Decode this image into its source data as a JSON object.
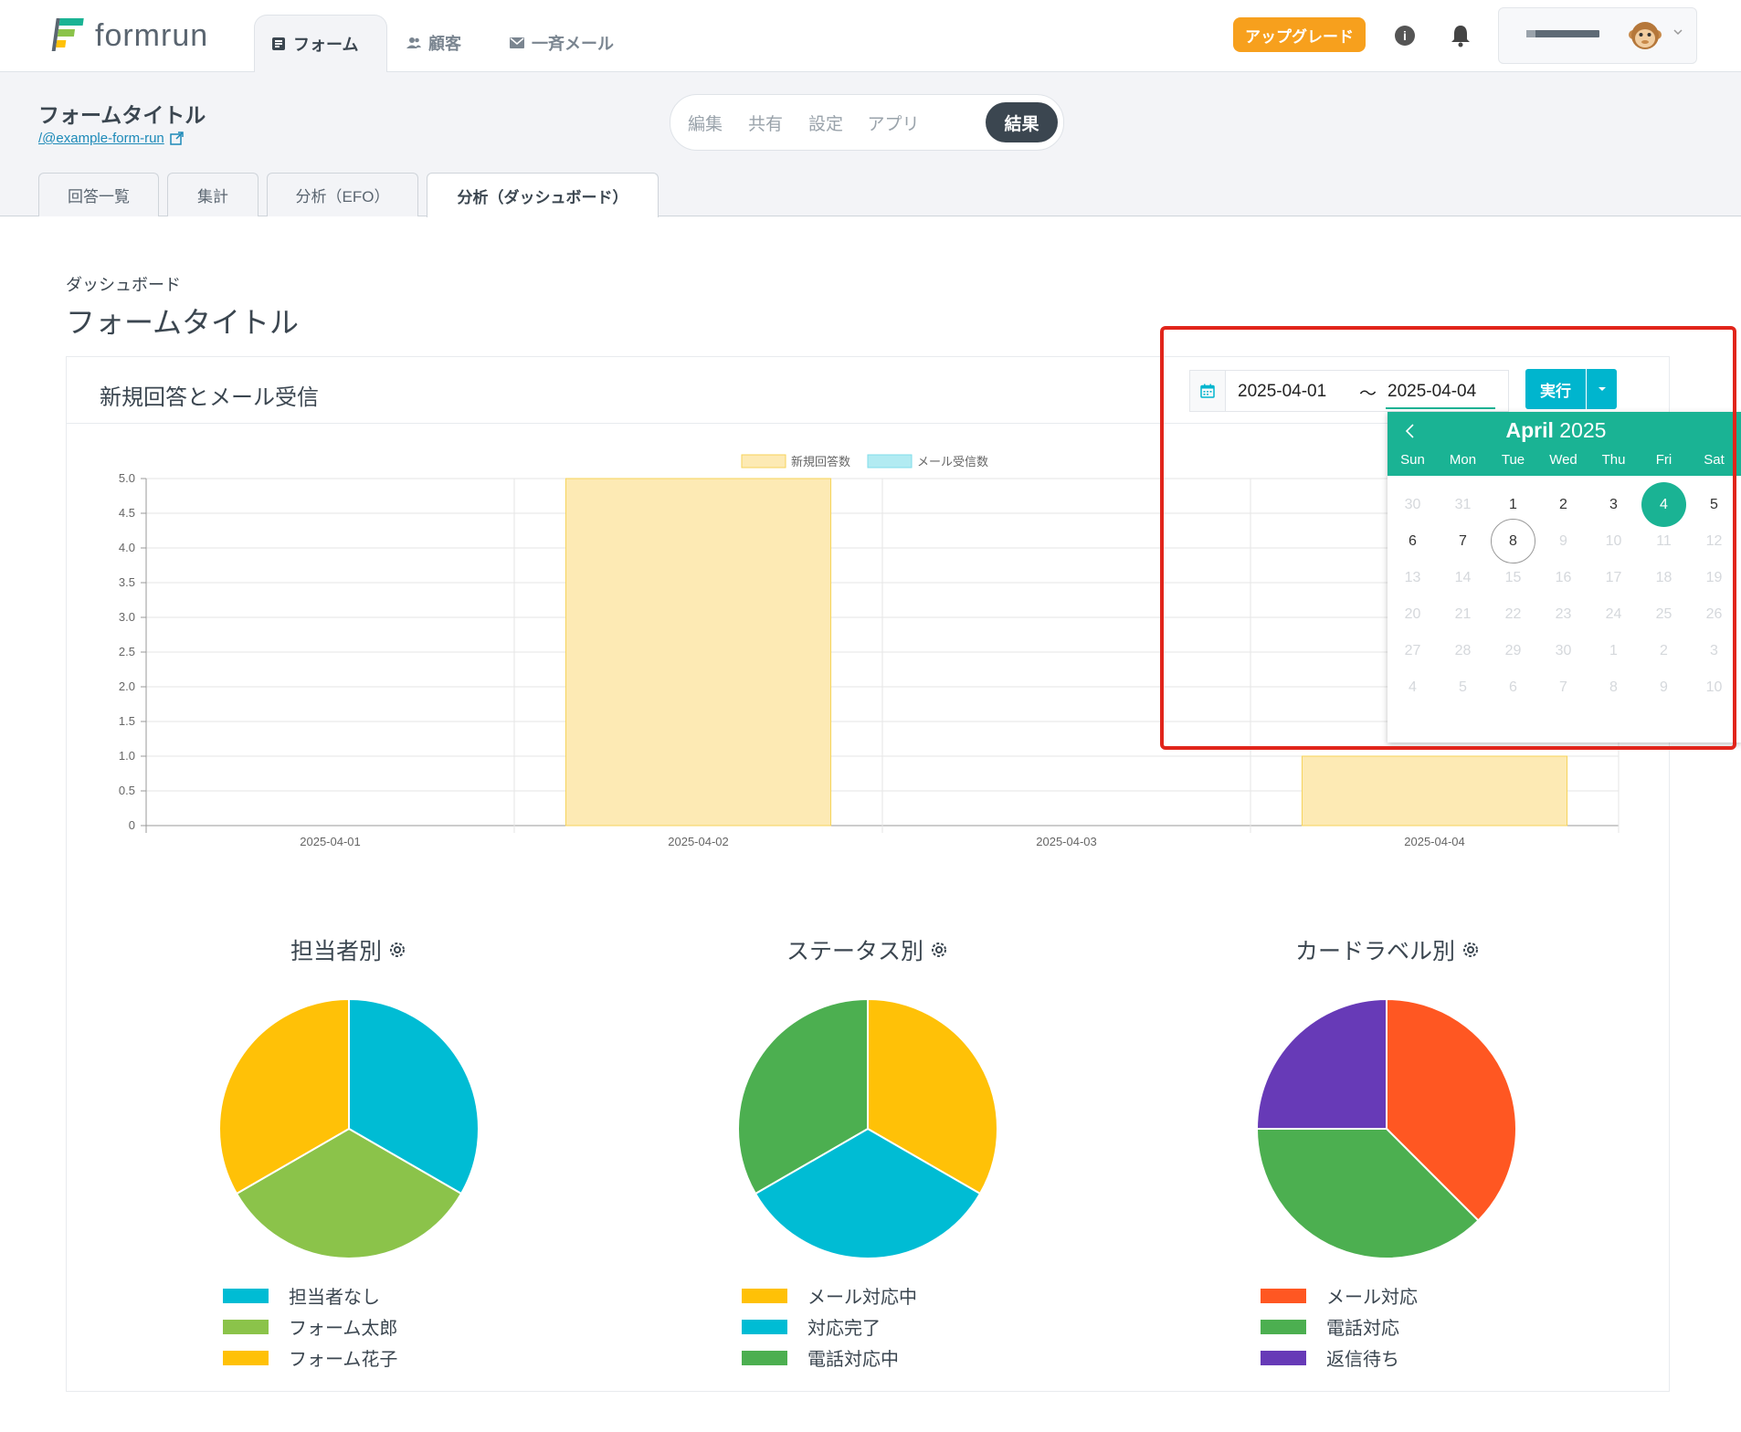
{
  "app": {
    "logo_text": "formrun",
    "nav_tabs": [
      {
        "label": "フォーム",
        "icon": "form-icon",
        "active": true
      },
      {
        "label": "顧客",
        "icon": "people-icon",
        "active": false
      },
      {
        "label": "一斉メール",
        "icon": "mail-icon",
        "active": false
      }
    ],
    "upgrade_label": "アップグレード",
    "info_icon": "i"
  },
  "form": {
    "title": "フォームタイトル",
    "link": "/@example-form-run",
    "segments": [
      "編集",
      "共有",
      "設定",
      "アプリ",
      "結果"
    ],
    "active_segment": "結果",
    "subtabs": [
      "回答一覧",
      "集計",
      "分析（EFO）",
      "分析（ダッシュボード）"
    ],
    "active_subtab": "分析（ダッシュボード）"
  },
  "dashboard": {
    "label": "ダッシュボード",
    "title": "フォームタイトル",
    "card_title": "新規回答とメール受信",
    "date_start": "2025-04-01",
    "date_separator": "〜",
    "date_end": "2025-04-04",
    "run_label": "実行"
  },
  "calendar": {
    "month": "April",
    "year": "2025",
    "weekdays": [
      "Sun",
      "Mon",
      "Tue",
      "Wed",
      "Thu",
      "Fri",
      "Sat"
    ],
    "weeks": [
      [
        {
          "d": "30",
          "faint": true
        },
        {
          "d": "31",
          "faint": true
        },
        {
          "d": "1"
        },
        {
          "d": "2"
        },
        {
          "d": "3"
        },
        {
          "d": "4",
          "selected": true
        },
        {
          "d": "5"
        }
      ],
      [
        {
          "d": "6"
        },
        {
          "d": "7"
        },
        {
          "d": "8",
          "today": true
        },
        {
          "d": "9",
          "faint": true
        },
        {
          "d": "10",
          "faint": true
        },
        {
          "d": "11",
          "faint": true
        },
        {
          "d": "12",
          "faint": true
        }
      ],
      [
        {
          "d": "13",
          "faint": true
        },
        {
          "d": "14",
          "faint": true
        },
        {
          "d": "15",
          "faint": true
        },
        {
          "d": "16",
          "faint": true
        },
        {
          "d": "17",
          "faint": true
        },
        {
          "d": "18",
          "faint": true
        },
        {
          "d": "19",
          "faint": true
        }
      ],
      [
        {
          "d": "20",
          "faint": true
        },
        {
          "d": "21",
          "faint": true
        },
        {
          "d": "22",
          "faint": true
        },
        {
          "d": "23",
          "faint": true
        },
        {
          "d": "24",
          "faint": true
        },
        {
          "d": "25",
          "faint": true
        },
        {
          "d": "26",
          "faint": true
        }
      ],
      [
        {
          "d": "27",
          "faint": true
        },
        {
          "d": "28",
          "faint": true
        },
        {
          "d": "29",
          "faint": true
        },
        {
          "d": "30",
          "faint": true
        },
        {
          "d": "1",
          "faint": true
        },
        {
          "d": "2",
          "faint": true
        },
        {
          "d": "3",
          "faint": true
        }
      ],
      [
        {
          "d": "4",
          "faint": true
        },
        {
          "d": "5",
          "faint": true
        },
        {
          "d": "6",
          "faint": true
        },
        {
          "d": "7",
          "faint": true
        },
        {
          "d": "8",
          "faint": true
        },
        {
          "d": "9",
          "faint": true
        },
        {
          "d": "10",
          "faint": true
        }
      ]
    ]
  },
  "colors": {
    "accent": "#1ab394",
    "run_button": "#00b5ce",
    "upgrade": "#f7a01d",
    "bar_new": "#fdeab4",
    "bar_mail": "#b2ebf2",
    "highlight": "#e1251b"
  },
  "chart_data": [
    {
      "type": "bar",
      "categories": [
        "2025-04-01",
        "2025-04-02",
        "2025-04-03",
        "2025-04-04"
      ],
      "series": [
        {
          "name": "新規回答数",
          "values": [
            0,
            5,
            0,
            1
          ],
          "color": "#fdeab4",
          "border": "#f6d35a"
        },
        {
          "name": "メール受信数",
          "values": [
            0,
            0,
            0,
            0
          ],
          "color": "#b2ebf2",
          "border": "#80deea"
        }
      ],
      "ylim": [
        0,
        5
      ],
      "yticks": [
        "0",
        "0.5",
        "1.0",
        "1.5",
        "2.0",
        "2.5",
        "3.0",
        "3.5",
        "4.0",
        "4.5",
        "5.0"
      ],
      "legend": "top-center",
      "grid": true
    },
    {
      "type": "pie",
      "title": "担当者別",
      "labels": [
        "担当者なし",
        "フォーム太郎",
        "フォーム花子"
      ],
      "values": [
        1,
        1,
        1
      ],
      "colors": [
        "#00bcd4",
        "#8bc34a",
        "#ffc107"
      ]
    },
    {
      "type": "pie",
      "title": "ステータス別",
      "labels": [
        "メール対応中",
        "対応完了",
        "電話対応中"
      ],
      "values": [
        1,
        1,
        1
      ],
      "colors": [
        "#ffc107",
        "#00bcd4",
        "#4caf50"
      ]
    },
    {
      "type": "pie",
      "title": "カードラベル別",
      "labels": [
        "メール対応",
        "電話対応",
        "返信待ち"
      ],
      "values": [
        3,
        3,
        2
      ],
      "colors": [
        "#ff5722",
        "#4caf50",
        "#673ab7"
      ]
    }
  ]
}
